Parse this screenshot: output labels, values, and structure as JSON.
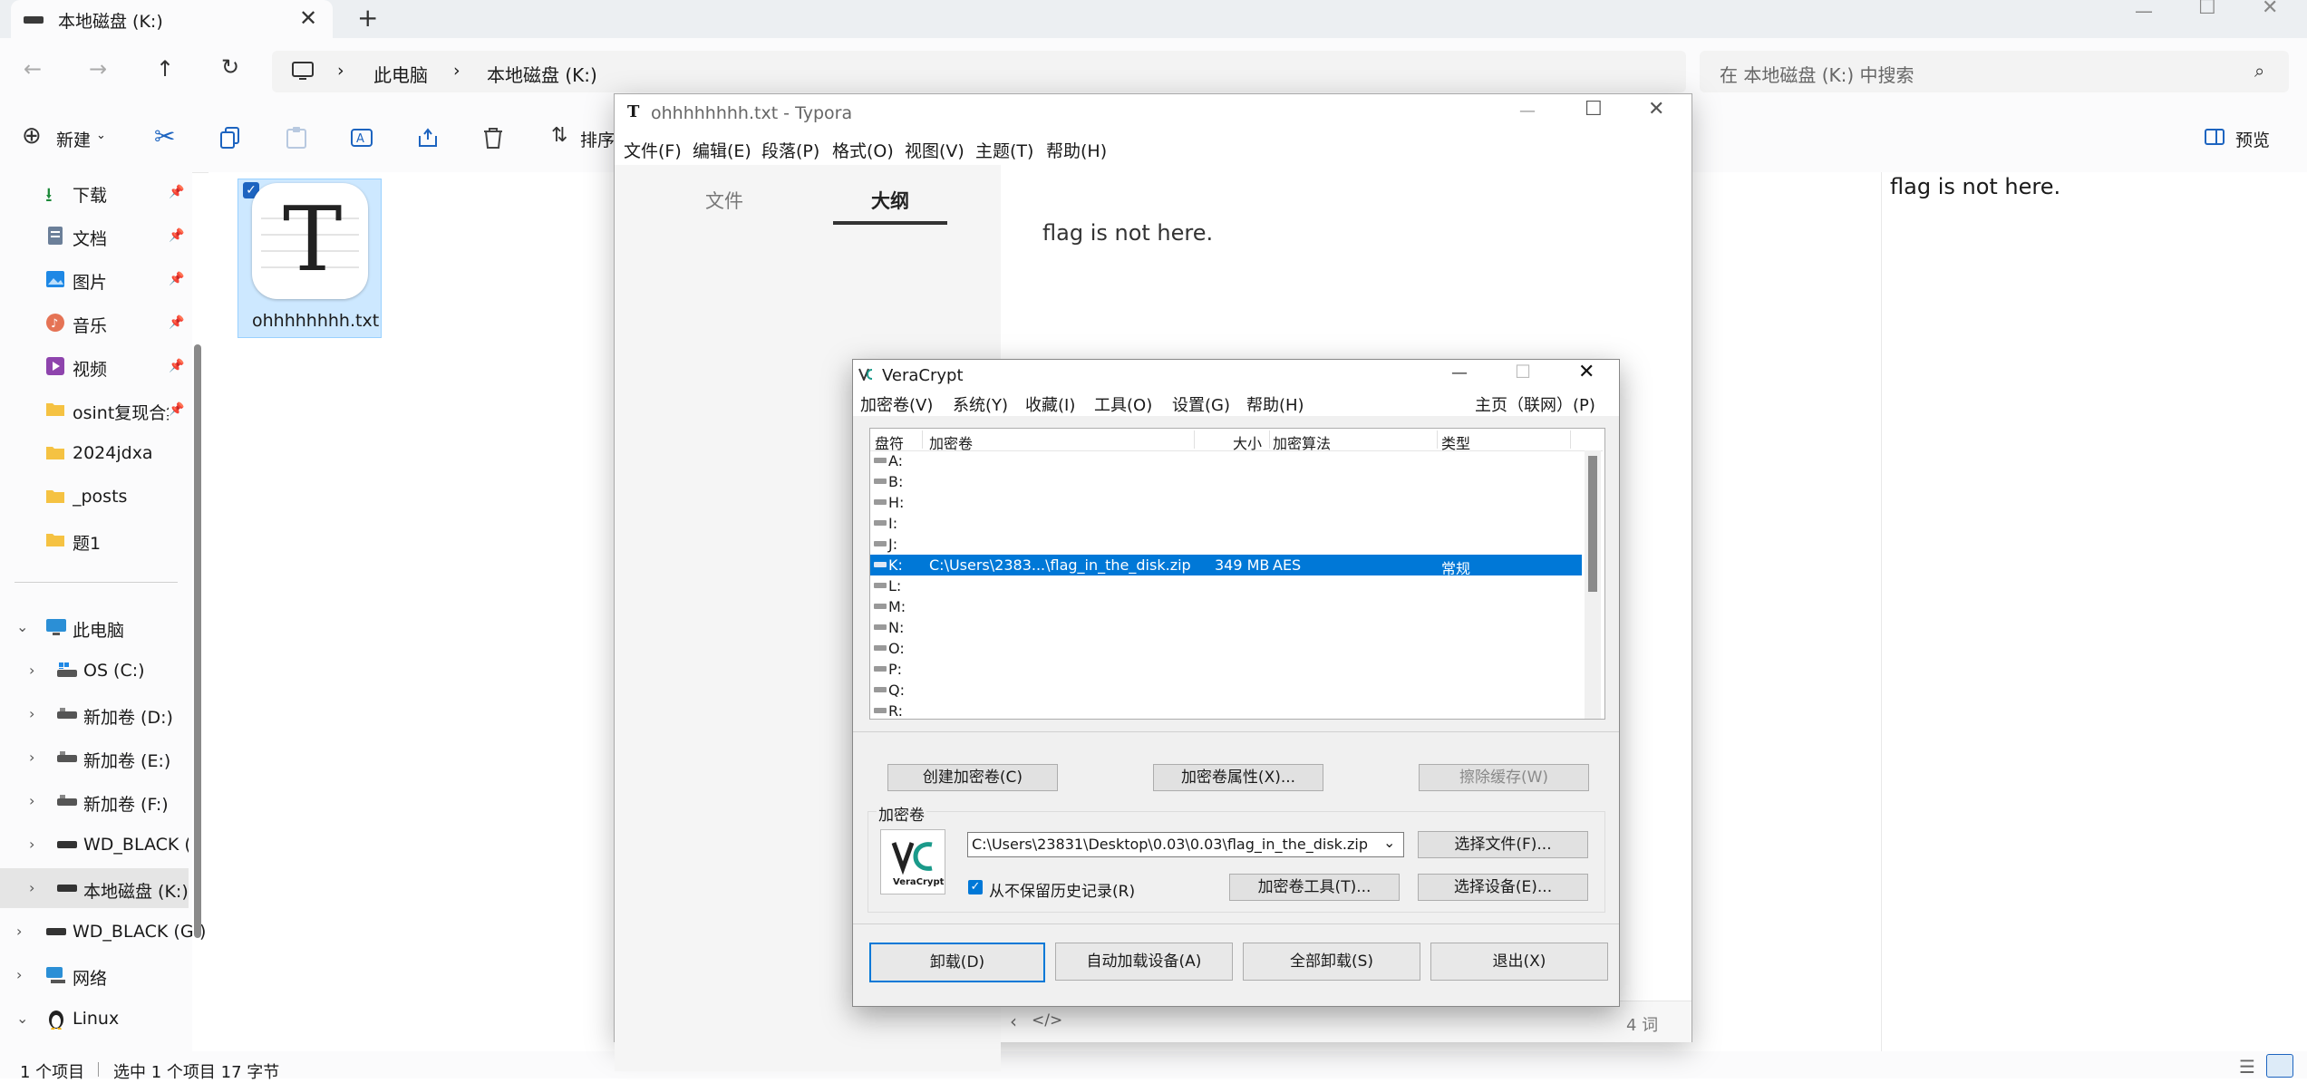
{
  "explorer": {
    "tab_title": "本地磁盘 (K:)",
    "breadcrumb": [
      "此电脑",
      "本地磁盘 (K:)"
    ],
    "search_placeholder": "在 本地磁盘 (K:) 中搜索",
    "toolbar": {
      "new_label": "新建",
      "sort_label": "排序",
      "preview_label": "预览"
    },
    "sidebar": {
      "quick_access": [
        {
          "label": "下载",
          "icon": "download-icon"
        },
        {
          "label": "文档",
          "icon": "document-icon"
        },
        {
          "label": "图片",
          "icon": "picture-icon"
        },
        {
          "label": "音乐",
          "icon": "music-icon"
        },
        {
          "label": "视频",
          "icon": "video-icon"
        },
        {
          "label": "osint复现合集",
          "icon": "folder-icon"
        },
        {
          "label": "2024jdxa",
          "icon": "folder-icon"
        },
        {
          "label": "_posts",
          "icon": "folder-icon"
        },
        {
          "label": "题1",
          "icon": "folder-icon"
        }
      ],
      "this_pc": "此电脑",
      "drives": [
        "OS (C:)",
        "新加卷 (D:)",
        "新加卷 (E:)",
        "新加卷 (F:)",
        "WD_BLACK (C",
        "本地磁盘 (K:)"
      ],
      "wd_black_g": "WD_BLACK (G:)",
      "network": "网络",
      "linux": "Linux"
    },
    "file": {
      "name": "ohhhhhhhh.txt"
    },
    "preview_text": "flag is not here.",
    "status": {
      "items": "1 个项目",
      "selected": "选中 1 个项目  17 字节"
    }
  },
  "typora": {
    "title": "ohhhhhhhh.txt - Typora",
    "menu": [
      "文件(F)",
      "编辑(E)",
      "段落(P)",
      "格式(O)",
      "视图(V)",
      "主题(T)",
      "帮助(H)"
    ],
    "tabs": [
      "文件",
      "大纲"
    ],
    "content": "flag is not here.",
    "word_count": "4 词"
  },
  "veracrypt": {
    "title": "VeraCrypt",
    "menu": [
      "加密卷(V)",
      "系统(Y)",
      "收藏(I)",
      "工具(O)",
      "设置(G)",
      "帮助(H)"
    ],
    "homepage": "主页（联网）(P)",
    "columns": [
      "盘符",
      "加密卷",
      "大小",
      "加密算法",
      "类型"
    ],
    "drives": [
      "A:",
      "B:",
      "H:",
      "I:",
      "J:",
      "K:",
      "L:",
      "M:",
      "N:",
      "O:",
      "P:",
      "Q:",
      "R:"
    ],
    "mounted": {
      "drive": "K:",
      "volume": "C:\\Users\\2383...\\flag_in_the_disk.zip",
      "size": "349 MB",
      "algorithm": "AES",
      "type": "常规"
    },
    "buttons": {
      "create": "创建加密卷(C)",
      "properties": "加密卷属性(X)...",
      "wipe": "擦除缓存(W)"
    },
    "volume_group": "加密卷",
    "volume_path": "C:\\Users\\23831\\Desktop\\0.03\\0.03\\flag_in_the_disk.zip",
    "select_file": "选择文件(F)...",
    "never_save_history": "从不保留历史记录(R)",
    "volume_tools": "加密卷工具(T)...",
    "select_device": "选择设备(E)...",
    "logo_text": "VeraCrypt",
    "bottom_buttons": [
      "卸载(D)",
      "自动加载设备(A)",
      "全部卸载(S)",
      "退出(X)"
    ]
  }
}
